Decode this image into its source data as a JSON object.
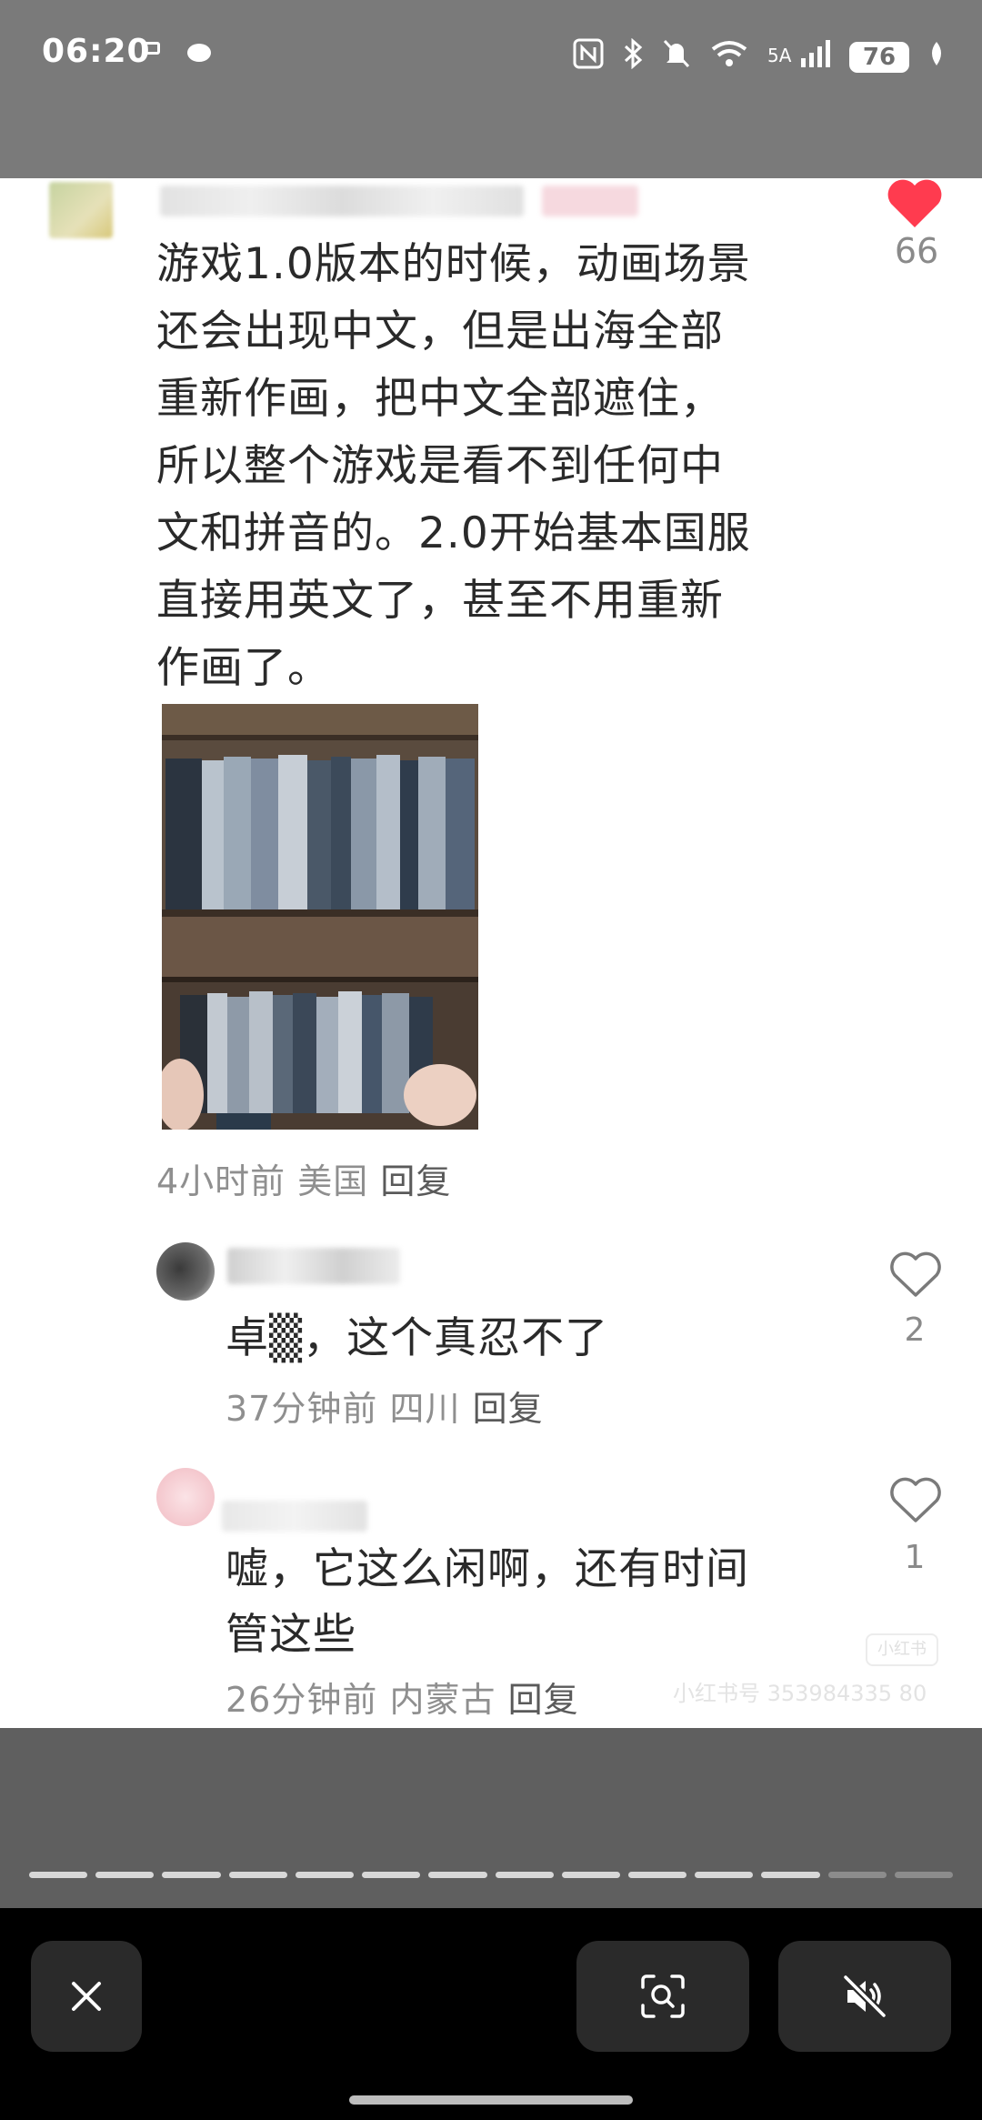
{
  "status_bar": {
    "time": "06:20",
    "battery": "76",
    "network_label": "5A",
    "icons": [
      "nfc-icon",
      "bluetooth-icon",
      "mute-icon",
      "wifi-icon",
      "signal-icon",
      "leaf-icon"
    ]
  },
  "main_comment": {
    "text_lines": [
      "游戏1.0版本的时候，动画场景",
      "还会出现中文，但是出海全部",
      "重新作画，把中文全部遮住，",
      "所以整个游戏是看不到任何中",
      "文和拼音的。2.0开始基本国服",
      "直接用英文了，甚至不用重新",
      "作画了。"
    ],
    "like_count": "66",
    "liked": true,
    "time": "4小时前",
    "location": "美国",
    "reply_label": "回复"
  },
  "replies": [
    {
      "text_lines": [
        "卓▒，这个真忍不了"
      ],
      "like_count": "2",
      "time": "37分钟前",
      "location": "四川",
      "reply_label": "回复"
    },
    {
      "text_lines": [
        "嘘，它这么闲啊，还有时间",
        "管这些"
      ],
      "like_count": "1",
      "time": "26分钟前",
      "location": "内蒙古",
      "reply_label": "回复"
    }
  ],
  "watermark": "小红书号 353984335 80",
  "watermark_logo": "小红书",
  "story_progress": {
    "total_segments": 14,
    "viewed_segments": 12
  },
  "controls": {
    "close_icon": "close-icon",
    "scan_icon": "visual-search-icon",
    "mute_icon": "volume-muted-icon"
  },
  "colors": {
    "like_red": "#ff3b4f",
    "card_bg": "#ffffff",
    "text": "#2a2a2a",
    "meta": "#8f8f8f"
  }
}
